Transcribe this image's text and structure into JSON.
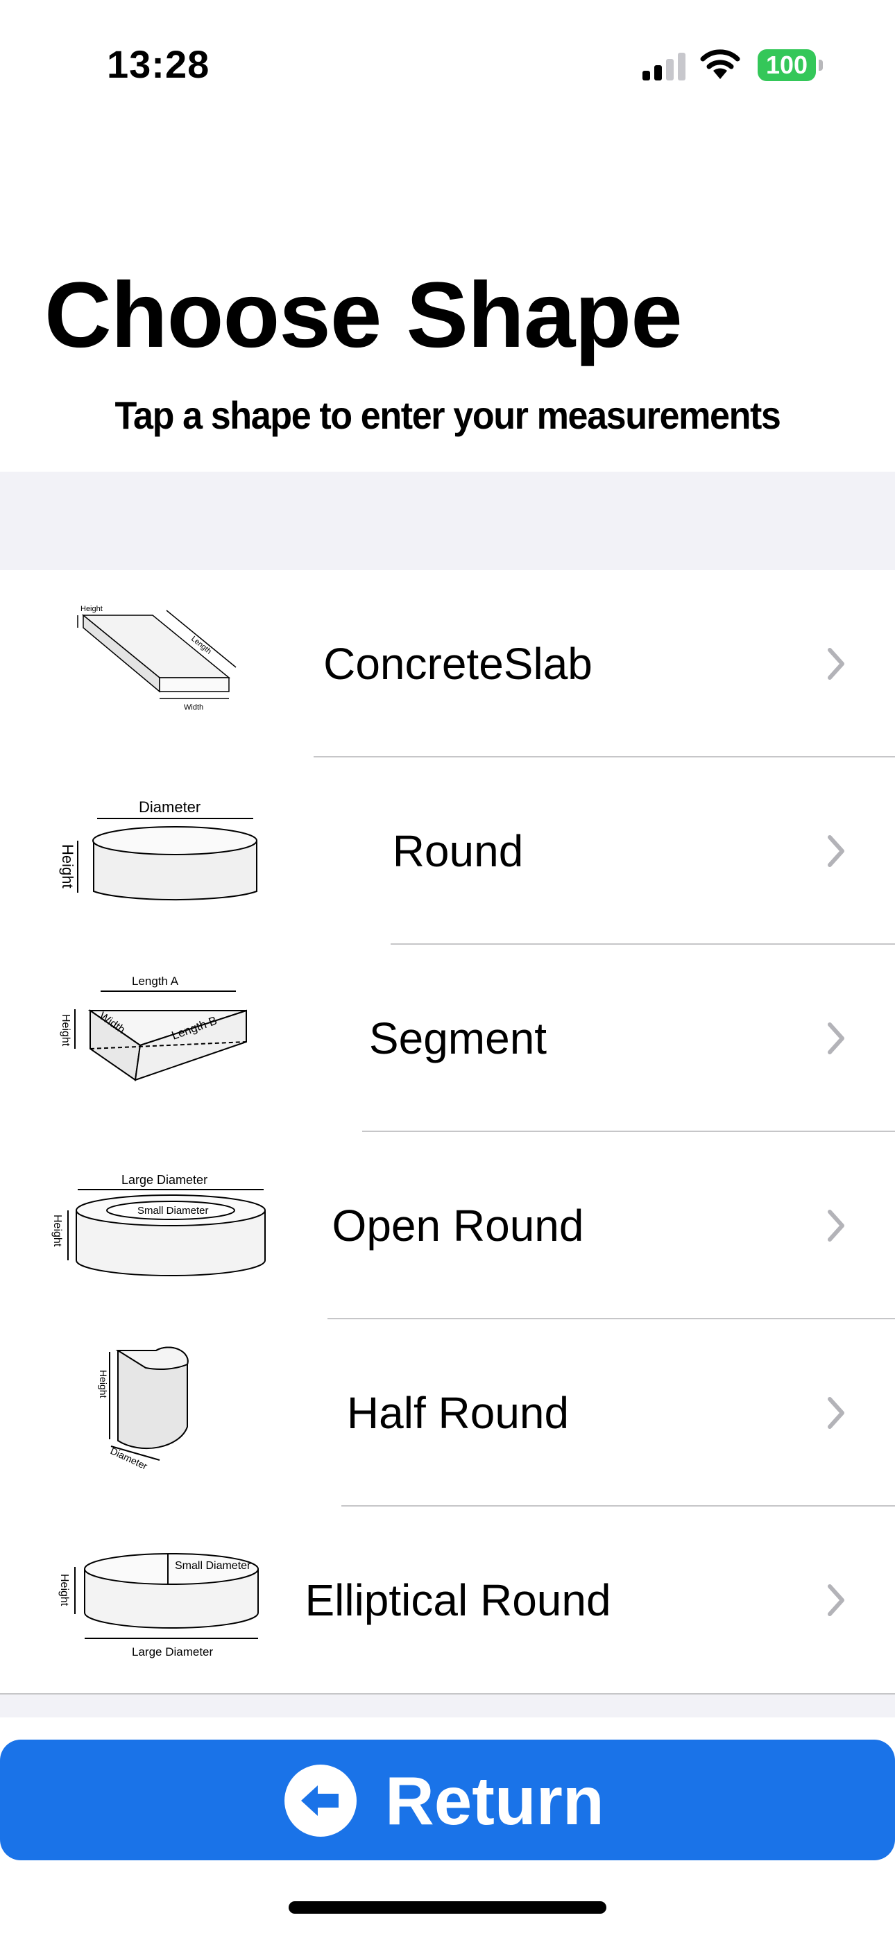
{
  "status_bar": {
    "time": "13:28",
    "battery_level": "100",
    "signal_bars": 2,
    "battery_color": "#34c759"
  },
  "header": {
    "title": "Choose Shape",
    "subtitle": "Tap a shape to enter your measurements"
  },
  "shapes": [
    {
      "label": "ConcreteSlab",
      "icon": "concrete-slab-diagram",
      "dims": [
        "Height",
        "Length",
        "Width"
      ]
    },
    {
      "label": "Round",
      "icon": "round-diagram",
      "dims": [
        "Diameter",
        "Height"
      ]
    },
    {
      "label": "Segment",
      "icon": "segment-diagram",
      "dims": [
        "Length A",
        "Length B",
        "Width",
        "Height"
      ]
    },
    {
      "label": "Open Round",
      "icon": "open-round-diagram",
      "dims": [
        "Large Diameter",
        "Small Diameter",
        "Height"
      ]
    },
    {
      "label": "Half Round",
      "icon": "half-round-diagram",
      "dims": [
        "Height",
        "Diameter"
      ]
    },
    {
      "label": "Elliptical Round",
      "icon": "elliptical-round-diagram",
      "dims": [
        "Small Diameter",
        "Large Diameter",
        "Height"
      ]
    }
  ],
  "return_button": {
    "label": "Return",
    "icon": "back-arrow-circle-icon",
    "color": "#1a73e8"
  }
}
